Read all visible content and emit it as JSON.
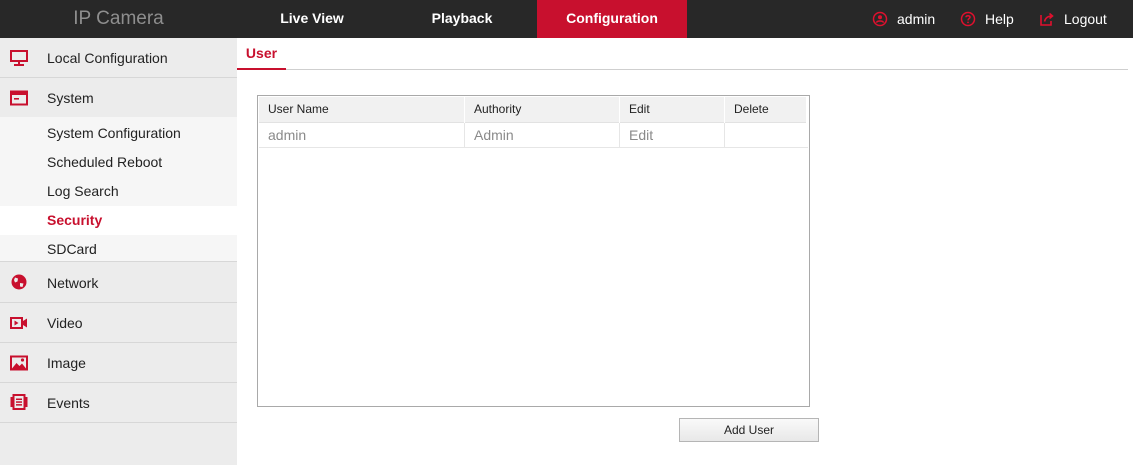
{
  "app": {
    "brand": "IP Camera"
  },
  "nav": {
    "live_view": "Live View",
    "playback": "Playback",
    "configuration": "Configuration",
    "active": "configuration"
  },
  "topbar_right": {
    "user": "admin",
    "help": "Help",
    "logout": "Logout"
  },
  "sidebar": {
    "local_configuration": "Local Configuration",
    "system": "System",
    "system_items": [
      {
        "label": "System Configuration",
        "active": false
      },
      {
        "label": "Scheduled Reboot",
        "active": false
      },
      {
        "label": "Log Search",
        "active": false
      },
      {
        "label": "Security",
        "active": true
      },
      {
        "label": "SDCard",
        "active": false
      }
    ],
    "network": "Network",
    "video": "Video",
    "image": "Image",
    "events": "Events"
  },
  "content": {
    "tab_label": "User",
    "table": {
      "headers": [
        "User Name",
        "Authority",
        "Edit",
        "Delete"
      ],
      "rows": [
        {
          "user_name": "admin",
          "authority": "Admin",
          "edit": "Edit",
          "delete": ""
        }
      ]
    },
    "add_user_label": "Add User"
  },
  "colors": {
    "accent": "#c8102e",
    "topbar_bg": "#282828",
    "sidebar_bg": "#ececec",
    "submenu_bg": "#f6f6f6"
  }
}
